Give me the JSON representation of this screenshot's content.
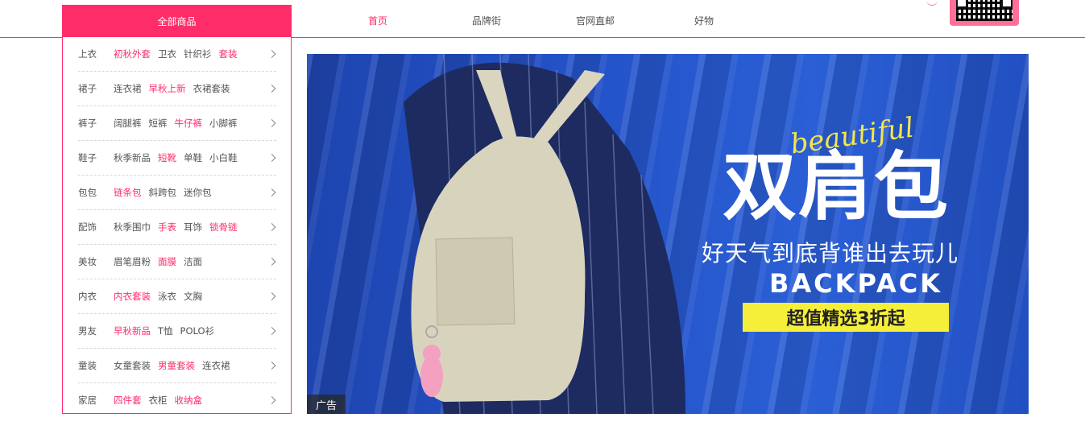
{
  "header": {
    "all_categories": "全部商品",
    "nav": [
      "首页",
      "品牌街",
      "官网直邮",
      "好物"
    ],
    "active_nav": "首页",
    "qr_icon": "qr-code-icon"
  },
  "menu": {
    "rows": [
      {
        "category": "上衣",
        "subs": [
          {
            "text": "初秋外套",
            "hot": true
          },
          {
            "text": "卫衣",
            "hot": false
          },
          {
            "text": "针织衫",
            "hot": false
          },
          {
            "text": "套装",
            "hot": true
          }
        ]
      },
      {
        "category": "裙子",
        "subs": [
          {
            "text": "连衣裙",
            "hot": false
          },
          {
            "text": "早秋上新",
            "hot": true
          },
          {
            "text": "衣裙套装",
            "hot": false
          }
        ]
      },
      {
        "category": "裤子",
        "subs": [
          {
            "text": "阔腿裤",
            "hot": false
          },
          {
            "text": "短裤",
            "hot": false
          },
          {
            "text": "牛仔裤",
            "hot": true
          },
          {
            "text": "小脚裤",
            "hot": false
          }
        ]
      },
      {
        "category": "鞋子",
        "subs": [
          {
            "text": "秋季新品",
            "hot": false
          },
          {
            "text": "短靴",
            "hot": true
          },
          {
            "text": "单鞋",
            "hot": false
          },
          {
            "text": "小白鞋",
            "hot": false
          }
        ]
      },
      {
        "category": "包包",
        "subs": [
          {
            "text": "链条包",
            "hot": true
          },
          {
            "text": "斜跨包",
            "hot": false
          },
          {
            "text": "迷你包",
            "hot": false
          }
        ]
      },
      {
        "category": "配饰",
        "subs": [
          {
            "text": "秋季围巾",
            "hot": false
          },
          {
            "text": "手表",
            "hot": true
          },
          {
            "text": "耳饰",
            "hot": false
          },
          {
            "text": "锁骨链",
            "hot": true
          }
        ]
      },
      {
        "category": "美妆",
        "subs": [
          {
            "text": "眉笔眉粉",
            "hot": false
          },
          {
            "text": "面膜",
            "hot": true
          },
          {
            "text": "洁面",
            "hot": false
          }
        ]
      },
      {
        "category": "内衣",
        "subs": [
          {
            "text": "内衣套装",
            "hot": true
          },
          {
            "text": "泳衣",
            "hot": false
          },
          {
            "text": "文胸",
            "hot": false
          }
        ]
      },
      {
        "category": "男友",
        "subs": [
          {
            "text": "早秋新品",
            "hot": true
          },
          {
            "text": "T恤",
            "hot": false
          },
          {
            "text": "POLO衫",
            "hot": false
          }
        ]
      },
      {
        "category": "童装",
        "subs": [
          {
            "text": "女童套装",
            "hot": false
          },
          {
            "text": "男童套装",
            "hot": true
          },
          {
            "text": "连衣裙",
            "hot": false
          }
        ]
      },
      {
        "category": "家居",
        "subs": [
          {
            "text": "四件套",
            "hot": true
          },
          {
            "text": "衣柜",
            "hot": false
          },
          {
            "text": "收纳盒",
            "hot": true
          }
        ]
      }
    ]
  },
  "banner": {
    "tag": "广告",
    "script_word": "beautiful",
    "title": "双肩包",
    "subtitle": "好天气到底背谁出去玩儿",
    "english": "BACKPACK",
    "badge": "超值精选3折起"
  },
  "colors": {
    "accent": "#ff2c6a",
    "banner_bg": "#2453c9",
    "badge_bg": "#f6ef3a"
  }
}
